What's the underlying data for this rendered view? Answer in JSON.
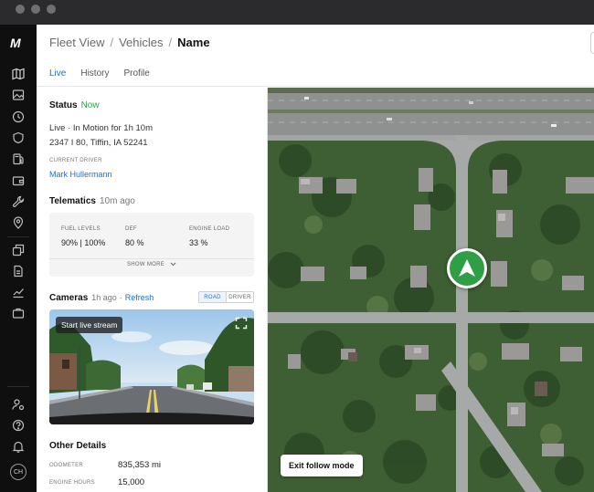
{
  "breadcrumb": {
    "item1": "Fleet View",
    "sep": "/",
    "item2": "Vehicles",
    "current": "Name"
  },
  "tabs": [
    {
      "label": "Live"
    },
    {
      "label": "History"
    },
    {
      "label": "Profile"
    }
  ],
  "rail": {
    "avatar_initials": "CH"
  },
  "status": {
    "title": "Status",
    "state": "Now",
    "line1": "Live  ·  In Motion for 1h 10m",
    "address": "2347 I 80, Tiffin, IA 52241",
    "driver_caption": "CURRENT DRIVER",
    "driver_name": "Mark Hullermann"
  },
  "telematics": {
    "title": "Telematics",
    "updated": "10m ago",
    "fuel_label": "FUEL LEVELS",
    "fuel_value": "90% | 100%",
    "def_label": "DEF",
    "def_value": "80 %",
    "engine_load_label": "ENGINE LOAD",
    "engine_load_value": "33 %",
    "show_more": "SHOW MORE"
  },
  "cameras": {
    "title": "Cameras",
    "updated": "1h ago",
    "refresh": "Refresh",
    "seg_road": "ROAD",
    "seg_driver": "DRIVER",
    "live_stream": "Start live stream"
  },
  "other": {
    "title": "Other Details",
    "odometer_label": "ODOMETER",
    "odometer_value": "835,353 mi",
    "engine_hours_label": "ENGINE HOURS",
    "engine_hours_value": "15,000"
  },
  "map": {
    "exit_follow": "Exit follow mode"
  },
  "colors": {
    "accent": "#1f6fc9",
    "vehicle": "#2f9e44",
    "status_ok": "#2aa64a",
    "rail": "#0f0f10"
  }
}
